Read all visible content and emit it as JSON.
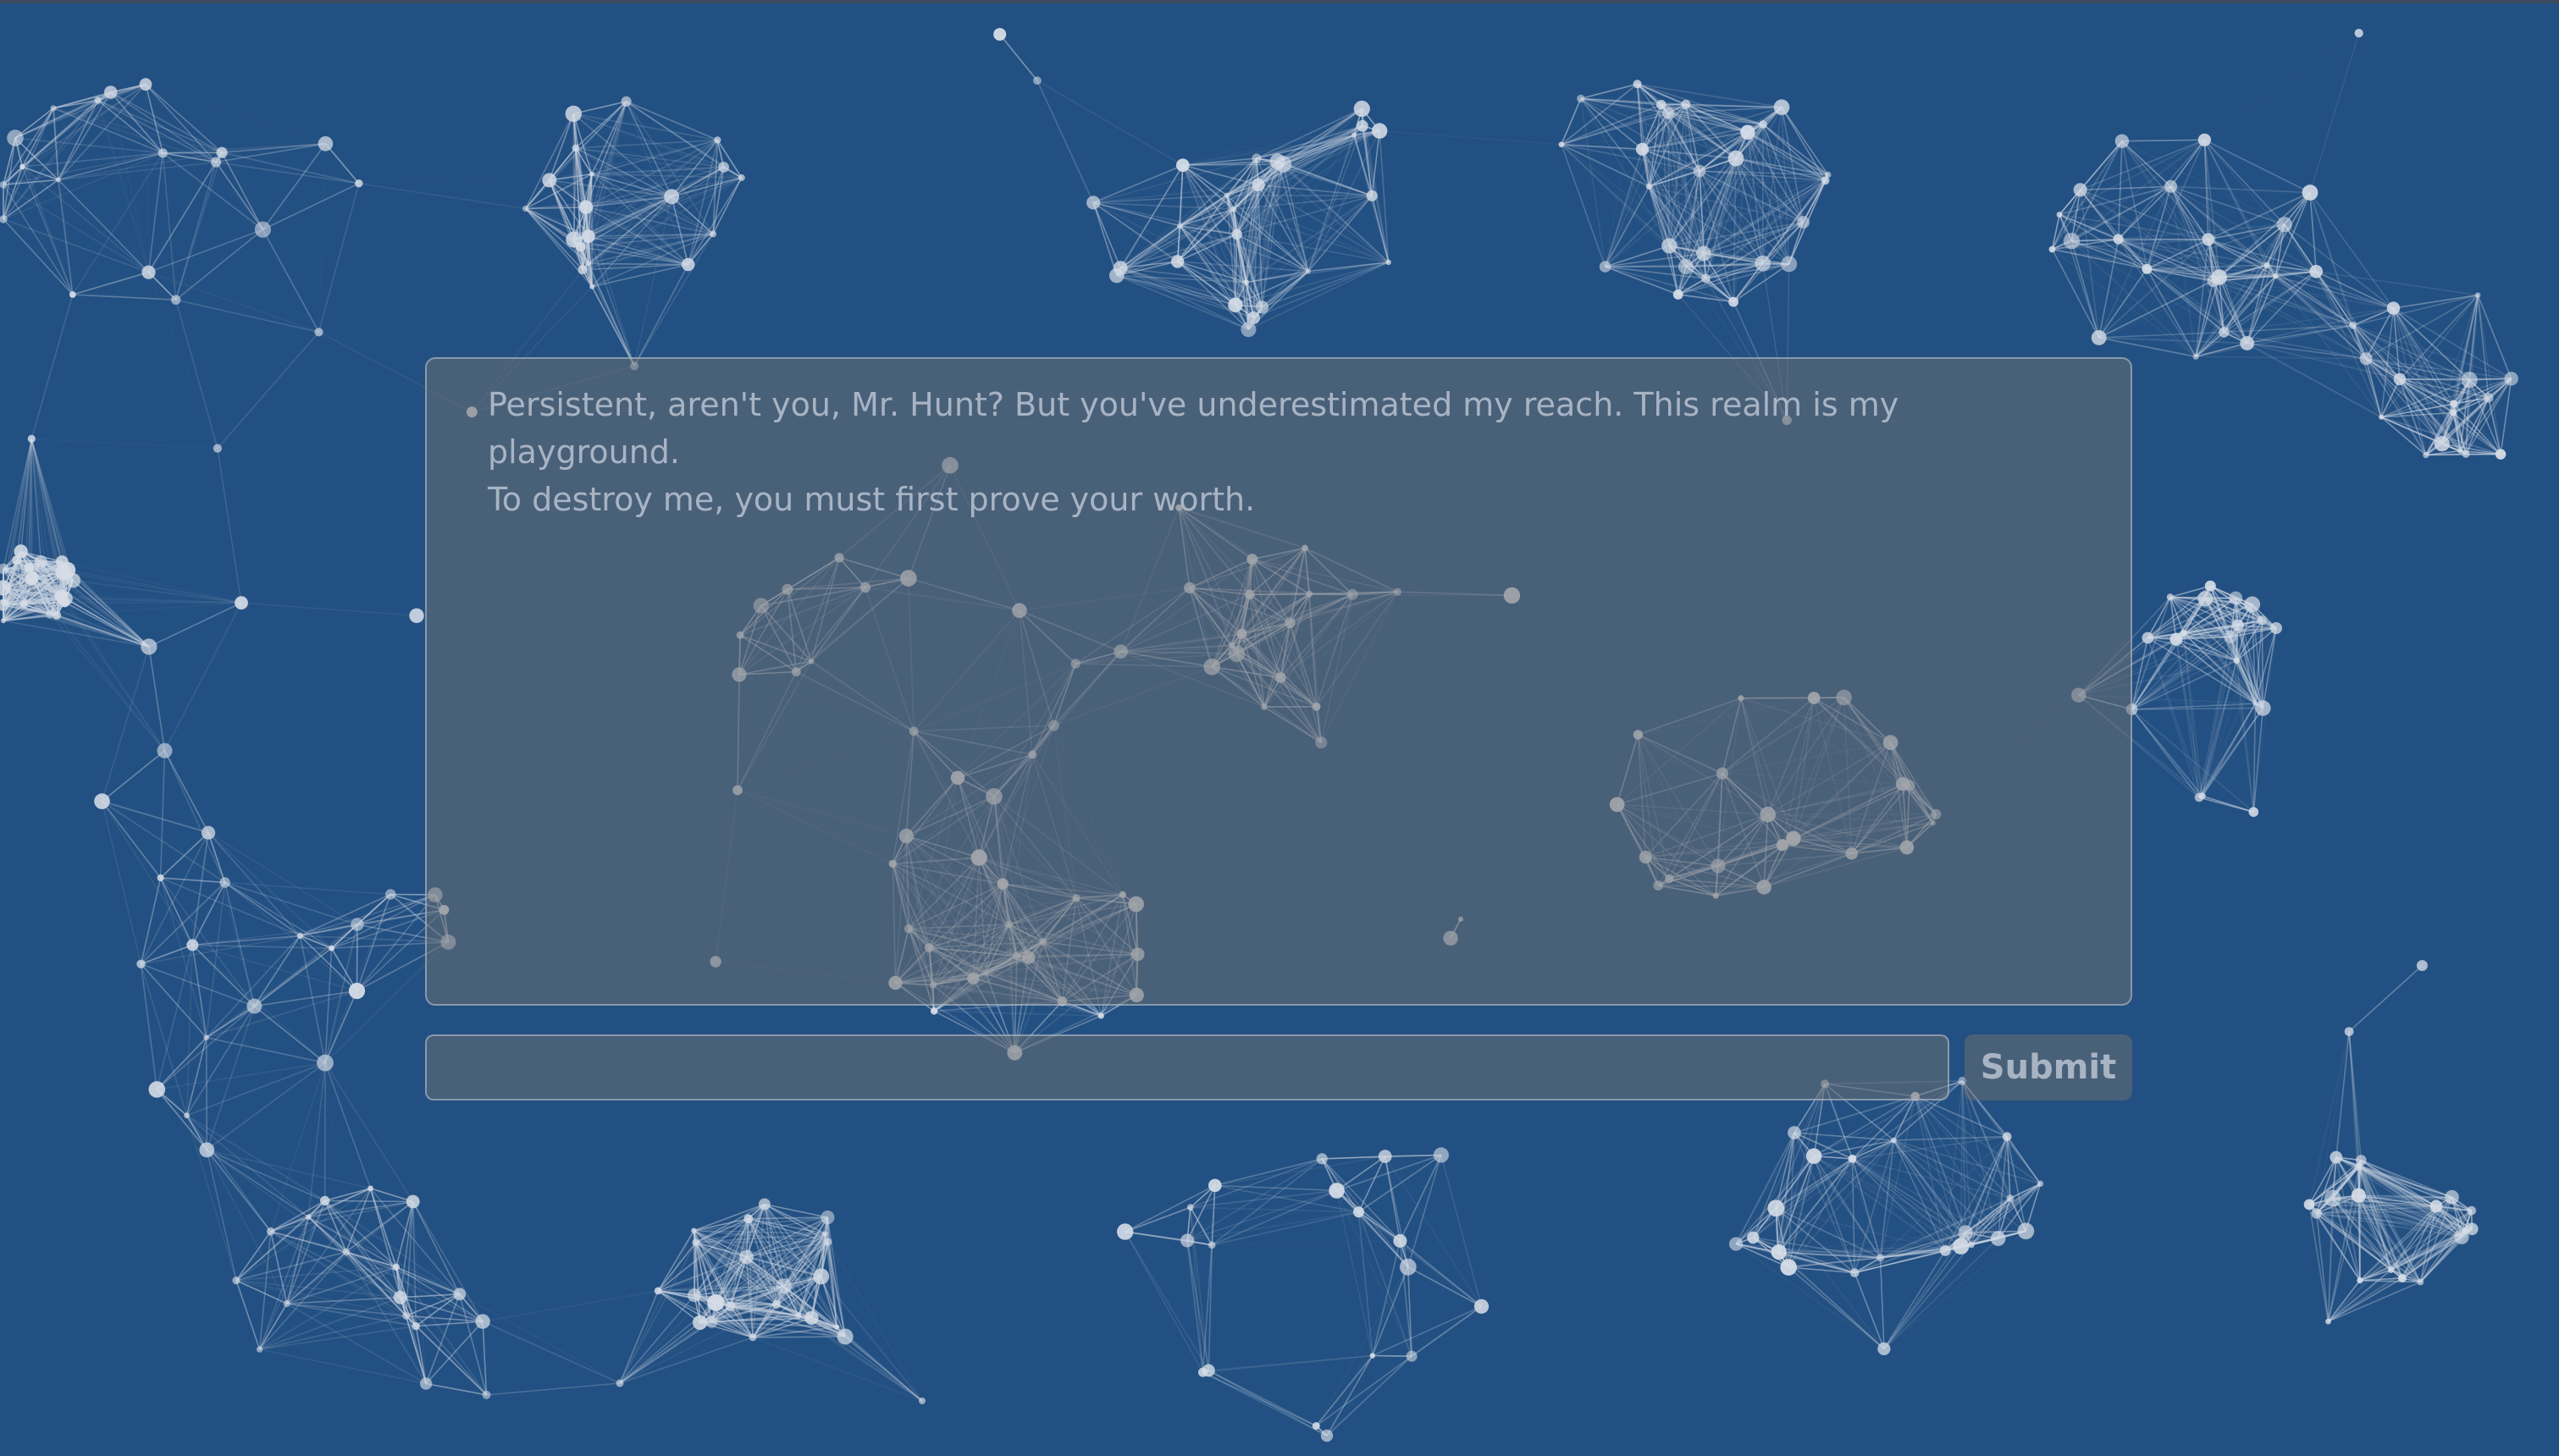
{
  "dialog": {
    "message": "Persistent, aren't you, Mr. Hunt? But you've underestimated my reach. This realm is my playground.\nTo destroy me, you must first prove your worth."
  },
  "input": {
    "value": "",
    "placeholder": ""
  },
  "submit": {
    "label": "Submit"
  },
  "colors": {
    "background": "#235082",
    "network_line": "#c8d2e0",
    "network_node": "#d6dde7"
  },
  "background_effect": "particle-network"
}
